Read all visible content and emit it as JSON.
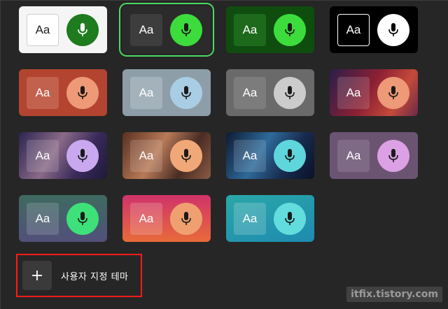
{
  "themes": [
    {
      "name": "white",
      "aa": "Aa",
      "bg": "#f5f5f5",
      "aa_bg": "#ffffff",
      "aa_color": "#222222",
      "aa_border": "#cfcfcf",
      "mic_bg": "#1e7b1e",
      "mic_color": "#ffffff",
      "selected": false
    },
    {
      "name": "dark-green",
      "aa": "Aa",
      "bg": "#2b2b2b",
      "aa_bg": "#3d3d3d",
      "aa_color": "#ffffff",
      "aa_border": "none",
      "mic_bg": "#3ddc3d",
      "mic_color": "#1a1a1a",
      "selected": true
    },
    {
      "name": "forest",
      "aa": "Aa",
      "bg": "#0f4d0f",
      "aa_bg": "#1d6a1d",
      "aa_color": "#ffffff",
      "aa_border": "none",
      "mic_bg": "#3ddc3d",
      "mic_color": "#1a1a1a",
      "selected": false
    },
    {
      "name": "black",
      "aa": "Aa",
      "bg": "#000000",
      "aa_bg": "#000000",
      "aa_color": "#ffffff",
      "aa_border": "#ffffff",
      "mic_bg": "#ffffff",
      "mic_color": "#000000",
      "selected": false
    },
    {
      "name": "rust",
      "aa": "Aa",
      "bg": "#b3442f",
      "aa_bg": "#c2614e",
      "aa_color": "#ffffff",
      "aa_border": "none",
      "mic_bg": "#ee9977",
      "mic_color": "#1a1a1a",
      "selected": false
    },
    {
      "name": "steel",
      "aa": "Aa",
      "bg": "#8e9ea8",
      "aa_bg": "#a4b2bb",
      "aa_color": "#ffffff",
      "aa_border": "none",
      "mic_bg": "#a9cde4",
      "mic_color": "#1a1a1a",
      "selected": false
    },
    {
      "name": "grey",
      "aa": "Aa",
      "bg": "#6a6a6a",
      "aa_bg": "#7c7c7c",
      "aa_color": "#ffffff",
      "aa_border": "none",
      "mic_bg": "#cccccc",
      "mic_color": "#1a1a1a",
      "selected": false
    },
    {
      "name": "crimson-wave",
      "aa": "Aa",
      "bg": "linear-gradient(120deg,#2a1e4a 0%,#8c2034 45%,#c44a3a 75%,#6a2a48 100%)",
      "aa_bg": "rgba(255,255,255,0.15)",
      "aa_color": "#ffffff",
      "aa_border": "none",
      "mic_bg": "#ee9977",
      "mic_color": "#1a1a1a",
      "selected": false
    },
    {
      "name": "violet-wave",
      "aa": "Aa",
      "bg": "linear-gradient(120deg,#2c2450 0%,#8a6a88 40%,#3a2a5a 70%,#1e1a3a 100%)",
      "aa_bg": "rgba(255,255,255,0.15)",
      "aa_color": "#ffffff",
      "aa_border": "none",
      "mic_bg": "#c9a8f0",
      "mic_color": "#1a1a1a",
      "selected": false
    },
    {
      "name": "bronze-wave",
      "aa": "Aa",
      "bg": "linear-gradient(120deg,#5a3020 0%,#b87a58 40%,#4a2c24 70%,#8a5a44 100%)",
      "aa_bg": "rgba(255,255,255,0.15)",
      "aa_color": "#ffffff",
      "aa_border": "none",
      "mic_bg": "#f0a878",
      "mic_color": "#1a1a1a",
      "selected": false
    },
    {
      "name": "ocean-wave",
      "aa": "Aa",
      "bg": "linear-gradient(120deg,#0e1a34 0%,#2e6a9a 40%,#182a4e 70%,#0a1228 100%)",
      "aa_bg": "rgba(255,255,255,0.15)",
      "aa_color": "#ffffff",
      "aa_border": "none",
      "mic_bg": "#5fd6dc",
      "mic_color": "#1a1a1a",
      "selected": false
    },
    {
      "name": "mauve",
      "aa": "Aa",
      "bg": "#6b5472",
      "aa_bg": "#7f6a86",
      "aa_color": "#ffffff",
      "aa_border": "none",
      "mic_bg": "#dca0e4",
      "mic_color": "#1a1a1a",
      "selected": false
    },
    {
      "name": "teal-purple",
      "aa": "Aa",
      "bg": "linear-gradient(180deg,#3e6a60 0%,#52507a 100%)",
      "aa_bg": "rgba(255,255,255,0.15)",
      "aa_color": "#ffffff",
      "aa_border": "none",
      "mic_bg": "#3ee07a",
      "mic_color": "#1a1a1a",
      "selected": false
    },
    {
      "name": "sunset",
      "aa": "Aa",
      "bg": "linear-gradient(180deg,#d0336a 0%,#e86a3a 100%)",
      "aa_bg": "rgba(255,255,255,0.18)",
      "aa_color": "#ffffff",
      "aa_border": "none",
      "mic_bg": "#f0a070",
      "mic_color": "#1a1a1a",
      "selected": false
    },
    {
      "name": "aqua",
      "aa": "Aa",
      "bg": "linear-gradient(160deg,#2aa8a8 0%,#1e8ab0 100%)",
      "aa_bg": "rgba(255,255,255,0.18)",
      "aa_color": "#ffffff",
      "aa_border": "none",
      "mic_bg": "#62dcdc",
      "mic_color": "#1a1a1a",
      "selected": false
    }
  ],
  "custom_theme": {
    "icon": "+",
    "label": "사용자 지정 테마",
    "highlight_color": "#ff1a1a"
  },
  "watermark": "itfix.tistory.com",
  "icons": {
    "mic": "microphone-icon",
    "plus": "plus-icon"
  }
}
